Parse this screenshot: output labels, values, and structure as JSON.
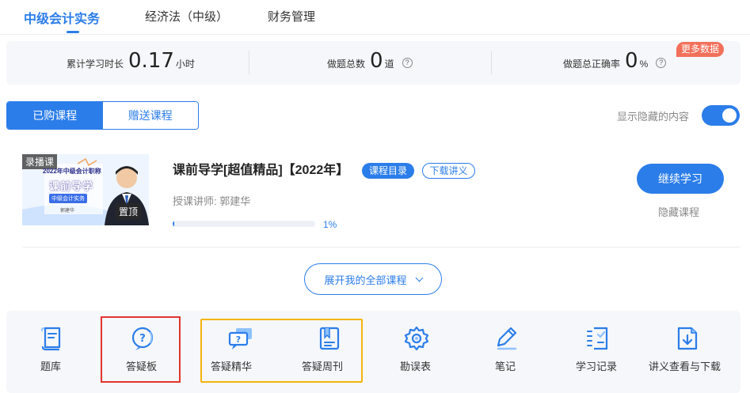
{
  "tabs": [
    {
      "label": "中级会计实务",
      "active": true
    },
    {
      "label": "经济法（中级）",
      "active": false
    },
    {
      "label": "财务管理",
      "active": false
    }
  ],
  "stats": {
    "study_time": {
      "label": "累计学习时长",
      "value": "0.17",
      "unit": "小时"
    },
    "total_questions": {
      "label": "做题总数",
      "value": "0",
      "unit": "道"
    },
    "accuracy": {
      "label": "做题总正确率",
      "value": "0",
      "unit": "%"
    },
    "more_badge": "更多数据"
  },
  "course_tabs": {
    "purchased": "已购课程",
    "gifted": "赠送课程"
  },
  "show_hidden": {
    "label": "显示隐藏的内容",
    "enabled": true
  },
  "course": {
    "thumb_tag": "录播课",
    "thumb_line1": "2022年中级会计职称",
    "thumb_line2": "课前导学",
    "thumb_line3": "中级会计实务",
    "thumb_line4": "郭建华",
    "pinned_tag": "置顶",
    "title": "课前导学[超值精品]【2022年】",
    "catalog_btn": "课程目录",
    "handout_btn": "下载讲义",
    "teacher": "授课讲师:   郭建华",
    "progress": 1,
    "progress_text": "1%",
    "continue_btn": "继续学习",
    "hide_btn": "隐藏课程"
  },
  "expand_btn": "展开我的全部课程",
  "tools": [
    {
      "label": "题库",
      "icon": "question-bank-icon"
    },
    {
      "label": "答疑板",
      "icon": "qa-board-icon"
    },
    {
      "label": "答疑精华",
      "icon": "qa-essence-icon"
    },
    {
      "label": "答疑周刊",
      "icon": "qa-weekly-icon"
    },
    {
      "label": "勘误表",
      "icon": "errata-icon"
    },
    {
      "label": "笔记",
      "icon": "notes-icon"
    },
    {
      "label": "学习记录",
      "icon": "study-record-icon"
    },
    {
      "label": "讲义查看与下载",
      "icon": "handout-download-icon"
    }
  ],
  "colors": {
    "accent": "#2b7de9",
    "badge": "#f2705a",
    "highlight_red": "#e3342f",
    "highlight_yellow": "#f5b40d"
  }
}
